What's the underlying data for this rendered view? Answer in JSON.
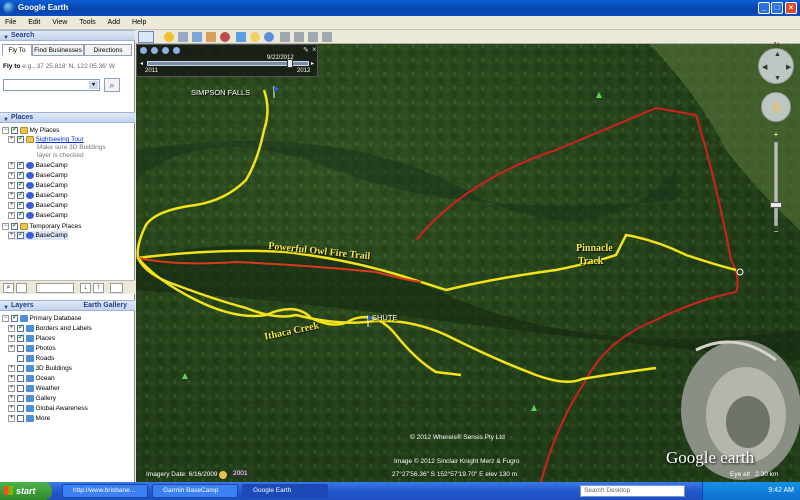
{
  "window": {
    "title": "Google Earth"
  },
  "menu": [
    "File",
    "Edit",
    "View",
    "Tools",
    "Add",
    "Help"
  ],
  "search": {
    "header": "Search",
    "tabs": [
      "Fly To",
      "Find Businesses",
      "Directions"
    ],
    "fly_to_label": "Fly to",
    "fly_to_hint": "e.g., 37 25.818' N, 122 05.36' W"
  },
  "places": {
    "header": "Places",
    "my_places": "My Places",
    "sightseeing": "Sightseeing Tour",
    "sightseeing_note_1": "Make sure 3D Buildings",
    "sightseeing_note_2": "layer is checked",
    "basecamp_items": [
      "BaseCamp",
      "BaseCamp",
      "BaseCamp",
      "BaseCamp",
      "BaseCamp",
      "BaseCamp"
    ],
    "temporary": "Temporary Places",
    "temp_item": "BaseCamp"
  },
  "layers": {
    "header": "Layers",
    "gallery_link": "Earth Gallery",
    "items": [
      "Primary Database",
      "Borders and Labels",
      "Places",
      "Photos",
      "Roads",
      "3D Buildings",
      "Ocean",
      "Weather",
      "Gallery",
      "Global Awareness",
      "More"
    ]
  },
  "timeslider": {
    "start": "2011",
    "end": "2012",
    "date": "9/22/2012"
  },
  "map": {
    "labels": {
      "simpson_falls": "SIMPSON FALLS",
      "shute": "SHUTE",
      "owl_trail": "Powerful Owl Fire Trail",
      "ithaca": "Ithaca Creek",
      "pinnacle_1": "Pinnacle",
      "pinnacle_2": "Track"
    },
    "credit_1": "© 2012 Whereis® Sensis Pty Ltd",
    "credit_2": "Image © 2012 Sinclair Knight Merz & Fugro",
    "imagery_date": "Imagery Date: 6/16/2009",
    "imagery_year": "2001",
    "coords": "27°27'56.36\" S 152°57'19.70\" E elev 130 m",
    "logo": "Google earth",
    "eye_alt": "Eye alt   2.30 km",
    "colors": {
      "trail": "#f2e31a",
      "road": "#d02020"
    }
  },
  "taskbar": {
    "start": "start",
    "items": [
      "http://www.brisbane...",
      "Garmin BaseCamp",
      "Google Earth"
    ],
    "search_placeholder": "Search Desktop",
    "clock": "9:42 AM"
  }
}
